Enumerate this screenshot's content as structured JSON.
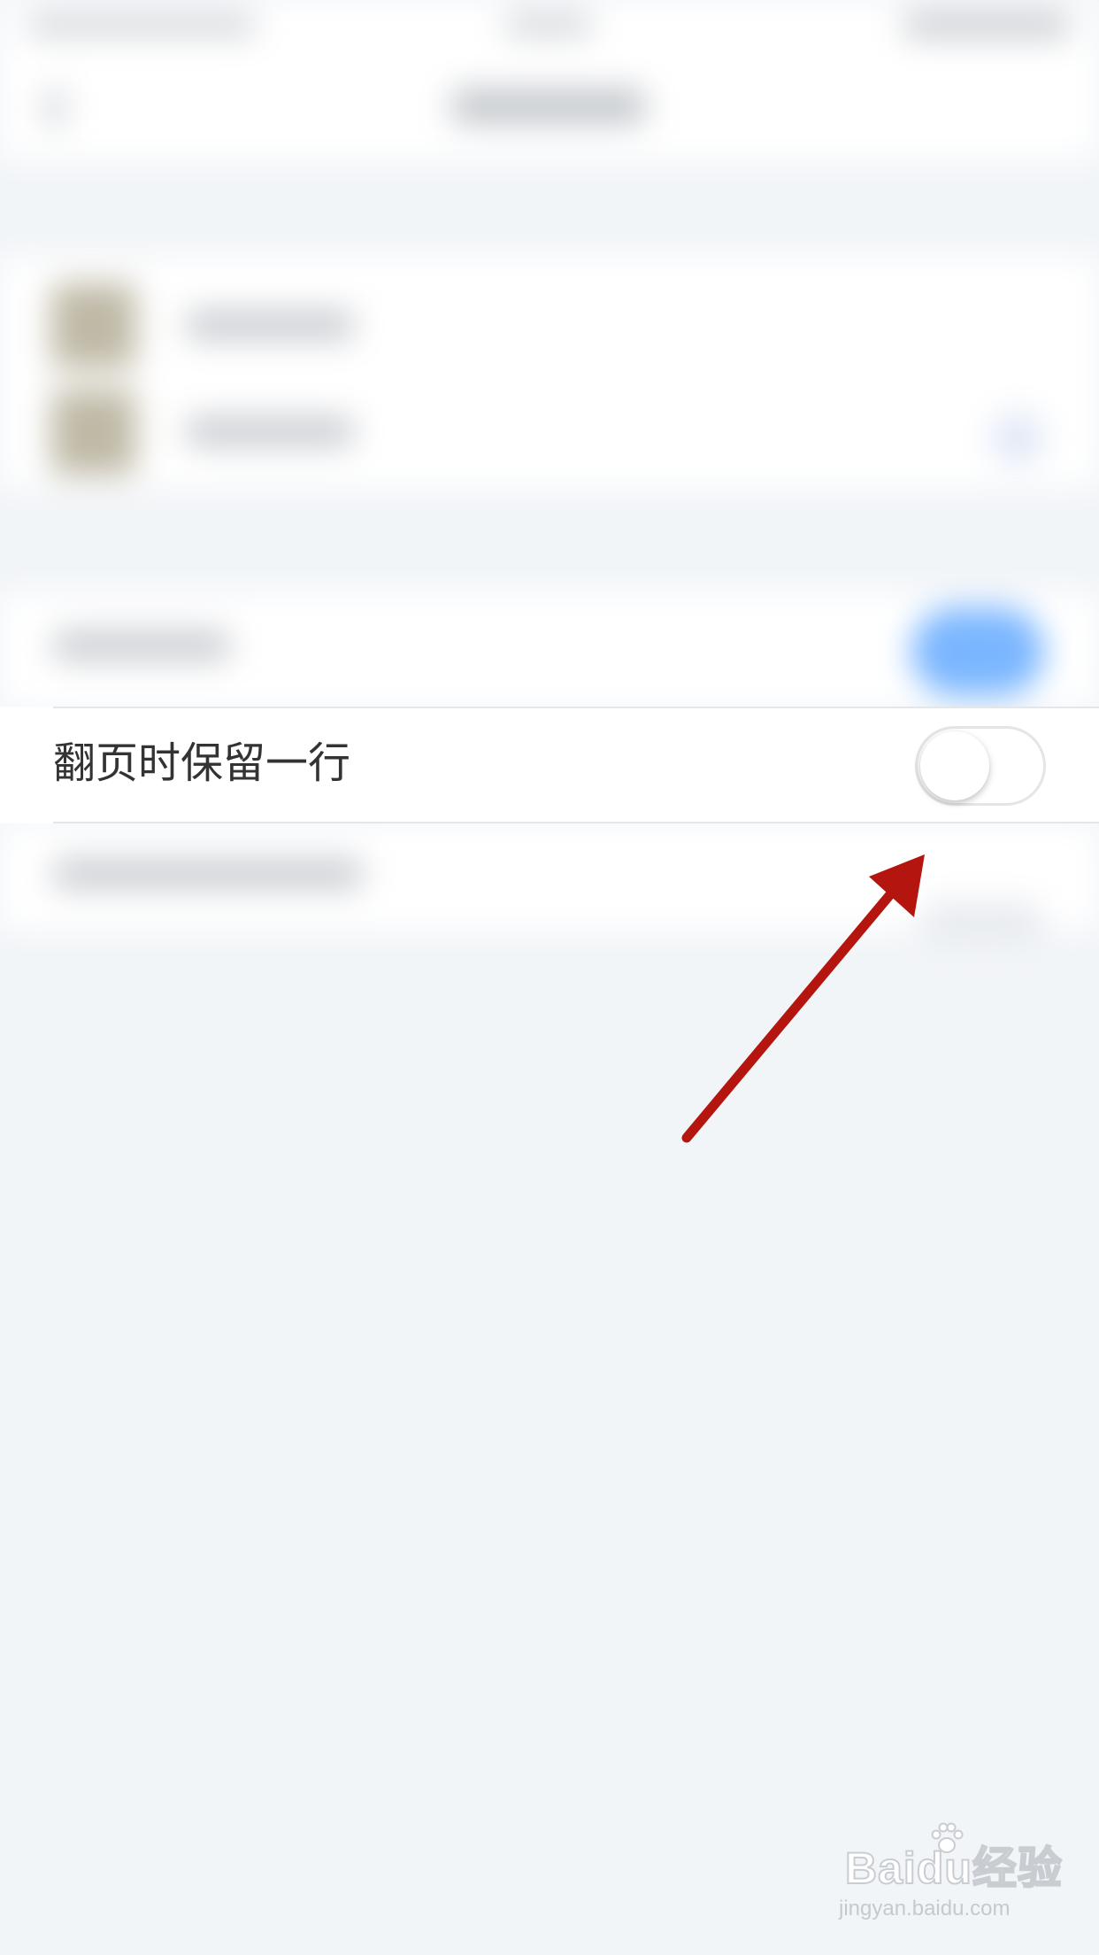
{
  "setting": {
    "label": "翻页时保留一行",
    "toggle_state": "off"
  },
  "colors": {
    "toggle_track": "#ffffff",
    "toggle_border": "#e5e5e5",
    "label_text": "#333333",
    "arrow": "#b5150f",
    "background": "#f2f5f8"
  },
  "watermark": {
    "logo_text": "Baidu经验",
    "url_text": "jingyan.baidu.com"
  }
}
